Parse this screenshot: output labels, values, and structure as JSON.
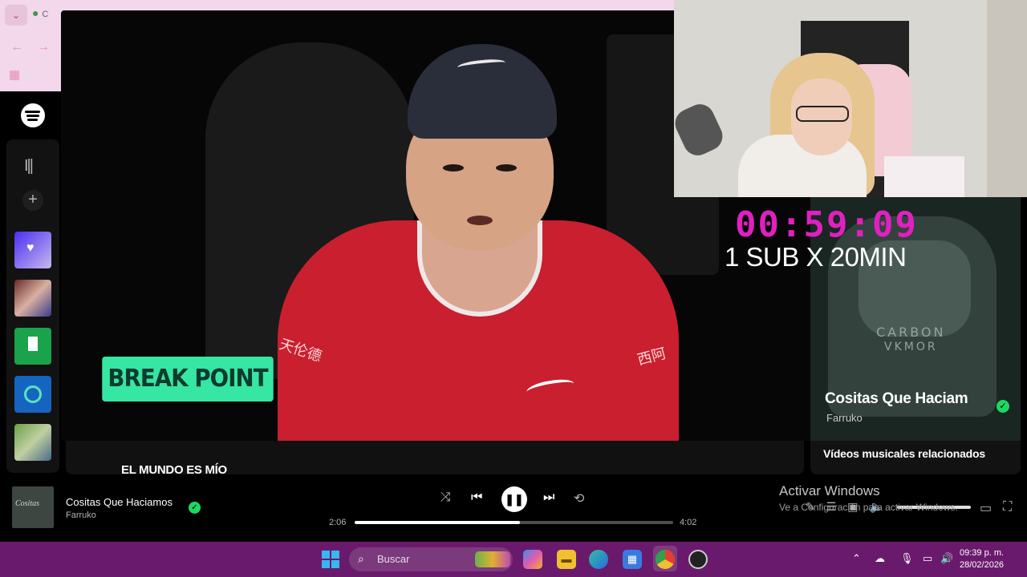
{
  "browser": {
    "tab_icon": "chevron-down-icon",
    "tab_text": "C"
  },
  "video": {
    "overlay_label": "BREAK POINT",
    "shirt_text_left": "天伦德",
    "shirt_text_right": "西阿"
  },
  "under_video": {
    "section_title": "EL MUNDO ES MÍO"
  },
  "now_playing_panel": {
    "album_art_text_1": "CARBON",
    "album_art_text_2": "VKMOR",
    "title": "Cositas Que Haciam",
    "artist": "Farruko",
    "related_heading": "Vídeos musicales relacionados"
  },
  "stream_overlay": {
    "timer": "00:59:09",
    "subtitle": "1 SUB X 20MIN"
  },
  "player": {
    "cover_text": "Cositas",
    "track_title": "Cositas Que Haciamos",
    "track_artist": "Farruko",
    "elapsed": "2:06",
    "duration": "4:02",
    "progress_fraction": 0.52,
    "volume_fraction": 0.85
  },
  "windows_watermark": {
    "title": "Activar Windows",
    "subtitle": "Ve a Configuración para activar Windows."
  },
  "taskbar": {
    "search_label": "Buscar",
    "clock_time": "09:39 p. m.",
    "clock_date": "28/02/2026"
  },
  "colors": {
    "spotify_green": "#1ed760",
    "timer_magenta": "#e020c0",
    "break_point_green": "#36e6a3",
    "taskbar_purple": "#6a1a6c"
  }
}
